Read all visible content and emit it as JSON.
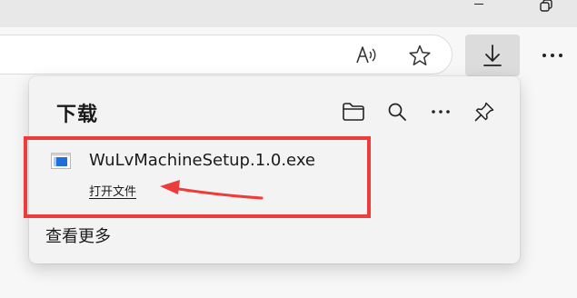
{
  "browser": {
    "window_controls": {
      "minimize_icon": "minimize-icon",
      "restore_icon": "restore-icon"
    },
    "toolbar": {
      "read_aloud_icon": "read-aloud-icon",
      "favorite_icon": "star-icon",
      "downloads_icon": "download-icon",
      "more_icon": "more-icon"
    }
  },
  "downloads_panel": {
    "title": "下载",
    "header_icons": [
      "folder-icon",
      "search-icon",
      "more-icon",
      "pin-icon"
    ],
    "items": [
      {
        "file_name": "WuLvMachineSetup.1.0.exe",
        "action_label": "打开文件",
        "icon": "installer-file-icon"
      }
    ],
    "see_more_label": "查看更多"
  },
  "annotation": {
    "highlight_color": "#ee3b3b",
    "arrow_color": "#ee3b3b"
  }
}
